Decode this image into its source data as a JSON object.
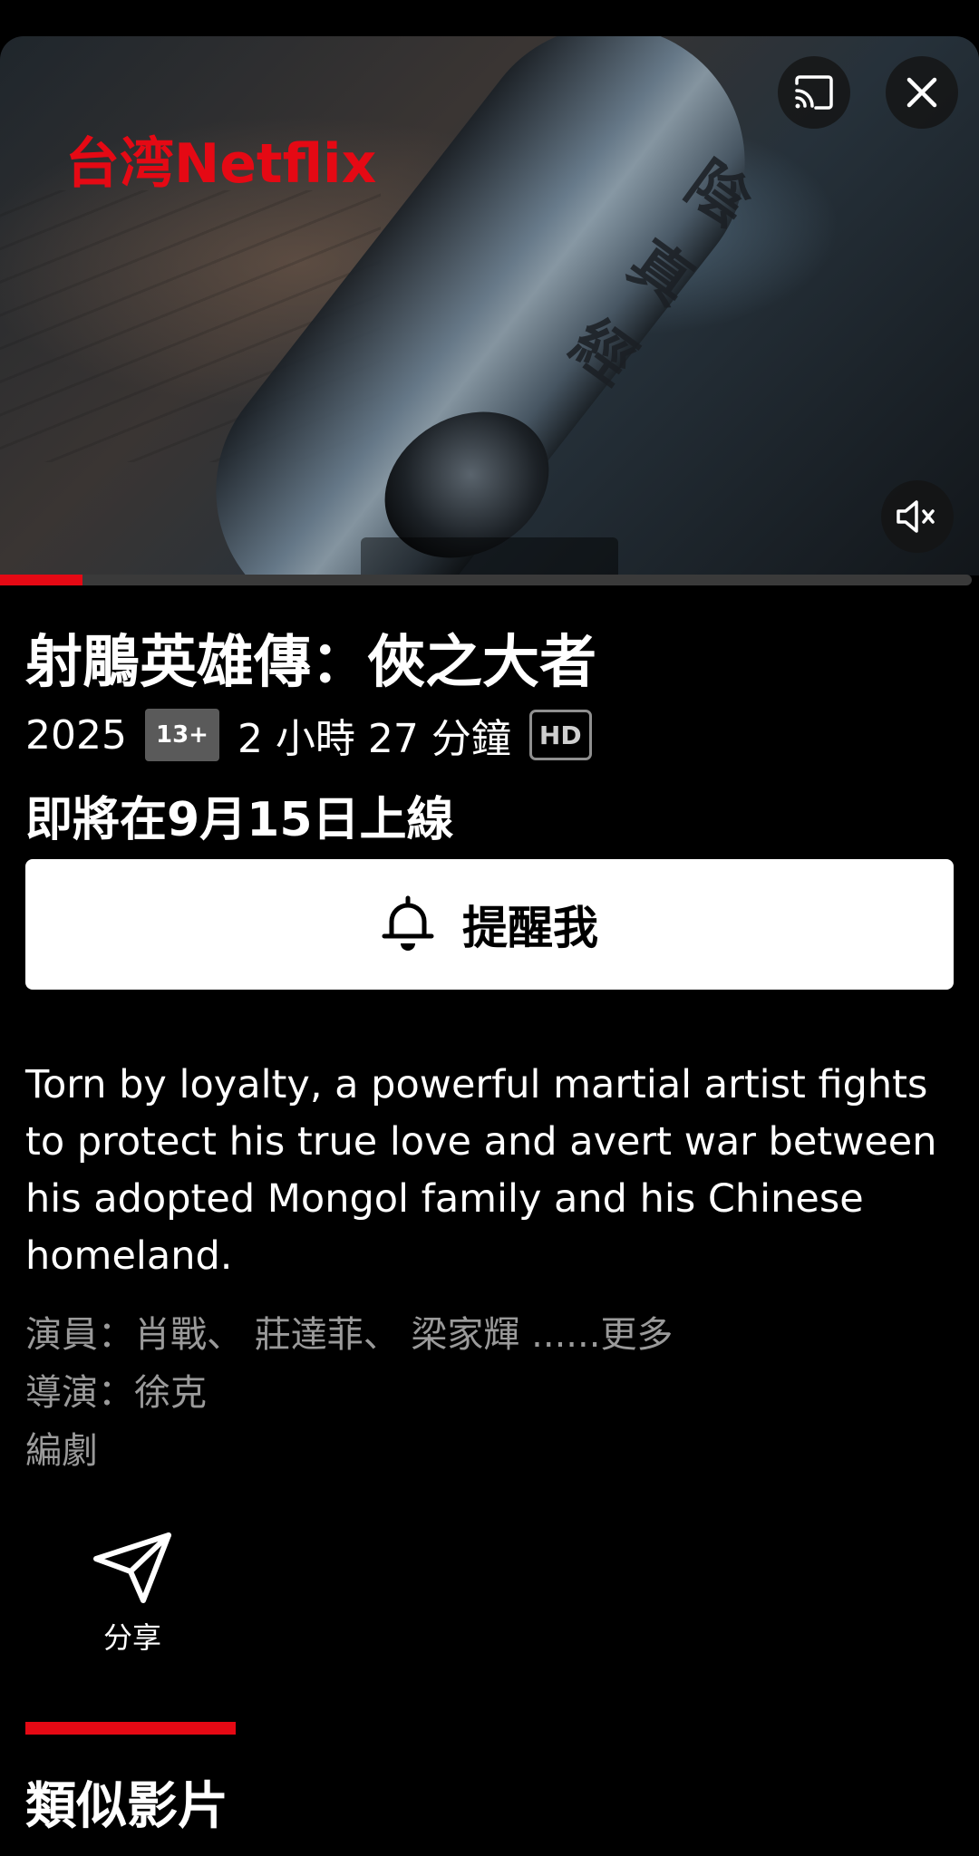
{
  "player": {
    "brand_watermark": "台湾Netflix",
    "scroll_glyphs": [
      "陰",
      "真",
      "經"
    ],
    "progress_fraction": 0.085,
    "icons": {
      "cast": "cast-icon",
      "close": "close-icon",
      "mute": "volume-muted-icon"
    }
  },
  "title": {
    "name": "射鵰英雄傳：俠之大者",
    "year": "2025",
    "rating": "13+",
    "duration": "2 小時 27 分鐘",
    "quality": "HD",
    "release_note": "即將在9月15日上線"
  },
  "actions": {
    "remind_label": "提醒我",
    "remind_icon": "bell-icon",
    "share_label": "分享",
    "share_icon": "send-icon"
  },
  "details": {
    "synopsis": "Torn by loyalty, a powerful martial artist fights to protect his true love and avert war between his adopted Mongol family and his Chinese homeland.",
    "cast_line": "演員：肖戰、 莊達菲、 梁家輝 ......",
    "cast_more": "更多",
    "director_line": "導演：徐克",
    "writer_line": "編劇"
  },
  "tabs": {
    "similar_label": "類似影片"
  },
  "colors": {
    "accent": "#e50914",
    "background": "#000000",
    "secondary_text": "#9a9a9a"
  }
}
